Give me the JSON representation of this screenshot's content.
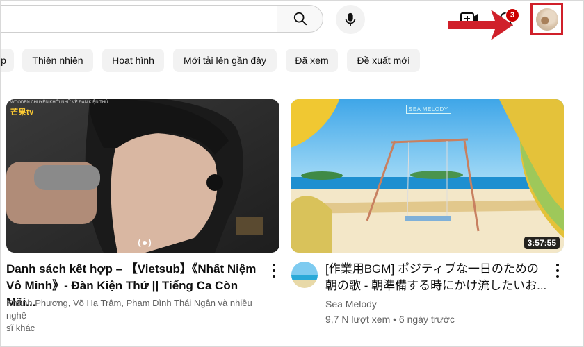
{
  "header": {
    "search_placeholder": "",
    "notification_count": "3"
  },
  "chips": [
    {
      "label": "p"
    },
    {
      "label": "Thiên nhiên"
    },
    {
      "label": "Hoạt hình"
    },
    {
      "label": "Mới tải lên gần đây"
    },
    {
      "label": "Đã xem"
    },
    {
      "label": "Đề xuất mới"
    }
  ],
  "videos": [
    {
      "title_line1": "Danh sách kết hợp – 【Vietsub】《Nhất Niệm",
      "title_line2": "Vô Minh》- Đàn Kiện Thứ || Tiếng Ca Còn Mãi...",
      "meta_line1": "Khánh Phương, Võ Hạ Trâm, Phạm Đình Thái Ngân và nhiều nghệ",
      "meta_line2": "sĩ khác",
      "thumb_brand": "芒果tv",
      "thumb_brand_top": "WOODEN CHUYÊN KHỞI NHỮ VỀ ĐÀN KIỆN THỨ"
    },
    {
      "title_line1": "[作業用BGM] ポジティブな一日のための",
      "title_line2": "朝の歌 - 朝準備する時にかけ流したいお...",
      "channel": "Sea Melody",
      "stats": "9,7 N lượt xem • 6 ngày trước",
      "duration": "3:57:55",
      "thumb_watermark": "SEA MELODY"
    }
  ],
  "colors": {
    "accent_red": "#cc0000",
    "highlight_box": "#d0202a",
    "chip_bg": "#f2f2f2"
  }
}
